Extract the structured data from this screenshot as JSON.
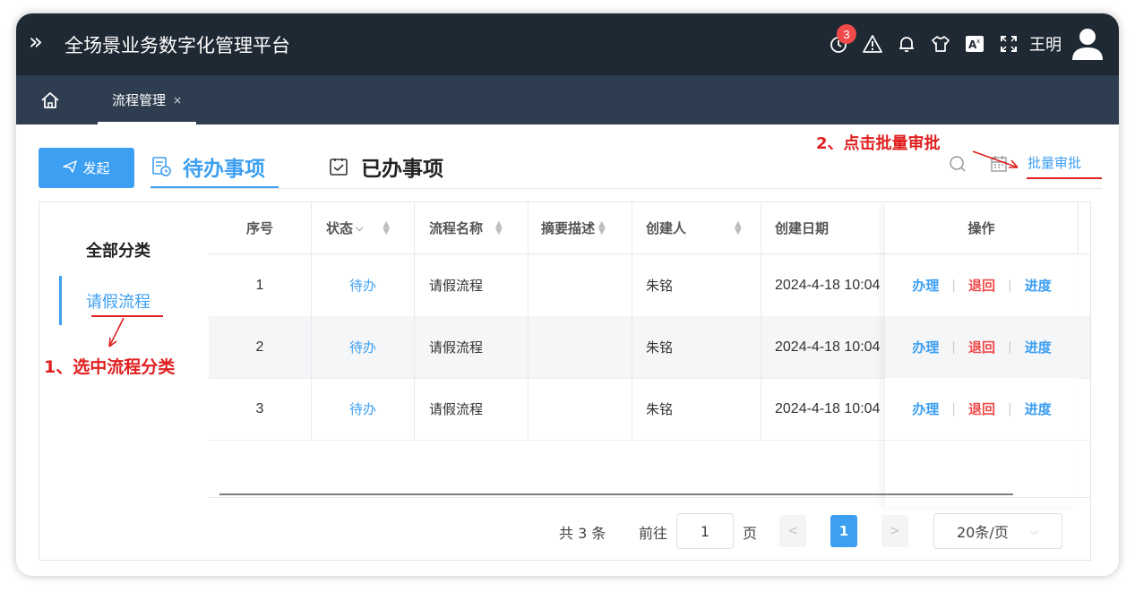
{
  "app": {
    "title": "全场景业务数字化管理平台",
    "user_name": "王明",
    "notification_count": "3"
  },
  "icons": {
    "menu_toggle": "double-chevron-right-icon",
    "history": "clock-icon",
    "alert": "warning-icon",
    "bell": "bell-icon",
    "theme": "shirt-icon",
    "translate": "translate-icon",
    "fullscreen": "fullscreen-icon",
    "avatar": "user-avatar-icon"
  },
  "tabs": {
    "home_icon": "home-icon",
    "open_tab": "流程管理",
    "close": "×"
  },
  "toolbar": {
    "start_label": "发起",
    "todo_label": "待办事项",
    "done_label": "已办事项",
    "batch_label": "批量审批"
  },
  "annotations": {
    "step2": "2、点击批量审批",
    "step1": "1、选中流程分类",
    "color": "#e02020"
  },
  "categories": {
    "all": "全部分类",
    "items": [
      "请假流程"
    ]
  },
  "table": {
    "columns": [
      "序号",
      "状态",
      "流程名称",
      "摘要描述",
      "创建人",
      "创建日期",
      "操作"
    ],
    "rows": [
      {
        "index": "1",
        "status": "待办",
        "name": "请假流程",
        "summary": "",
        "creator": "朱铭",
        "date": "2024-4-18 10:04"
      },
      {
        "index": "2",
        "status": "待办",
        "name": "请假流程",
        "summary": "",
        "creator": "朱铭",
        "date": "2024-4-18 10:04"
      },
      {
        "index": "3",
        "status": "待办",
        "name": "请假流程",
        "summary": "",
        "creator": "朱铭",
        "date": "2024-4-18 10:04"
      }
    ],
    "actions": {
      "handle": "办理",
      "return": "退回",
      "progress": "进度"
    }
  },
  "pagination": {
    "total": "共 3 条",
    "goto": "前往",
    "page_input": "1",
    "page_suffix": "页",
    "current_page": "1",
    "page_size": "20条/页"
  },
  "colors": {
    "primary": "#3d9ff2",
    "topbar": "#1f2933",
    "tabbar": "#2e3d4f",
    "danger": "#f04a4a"
  }
}
